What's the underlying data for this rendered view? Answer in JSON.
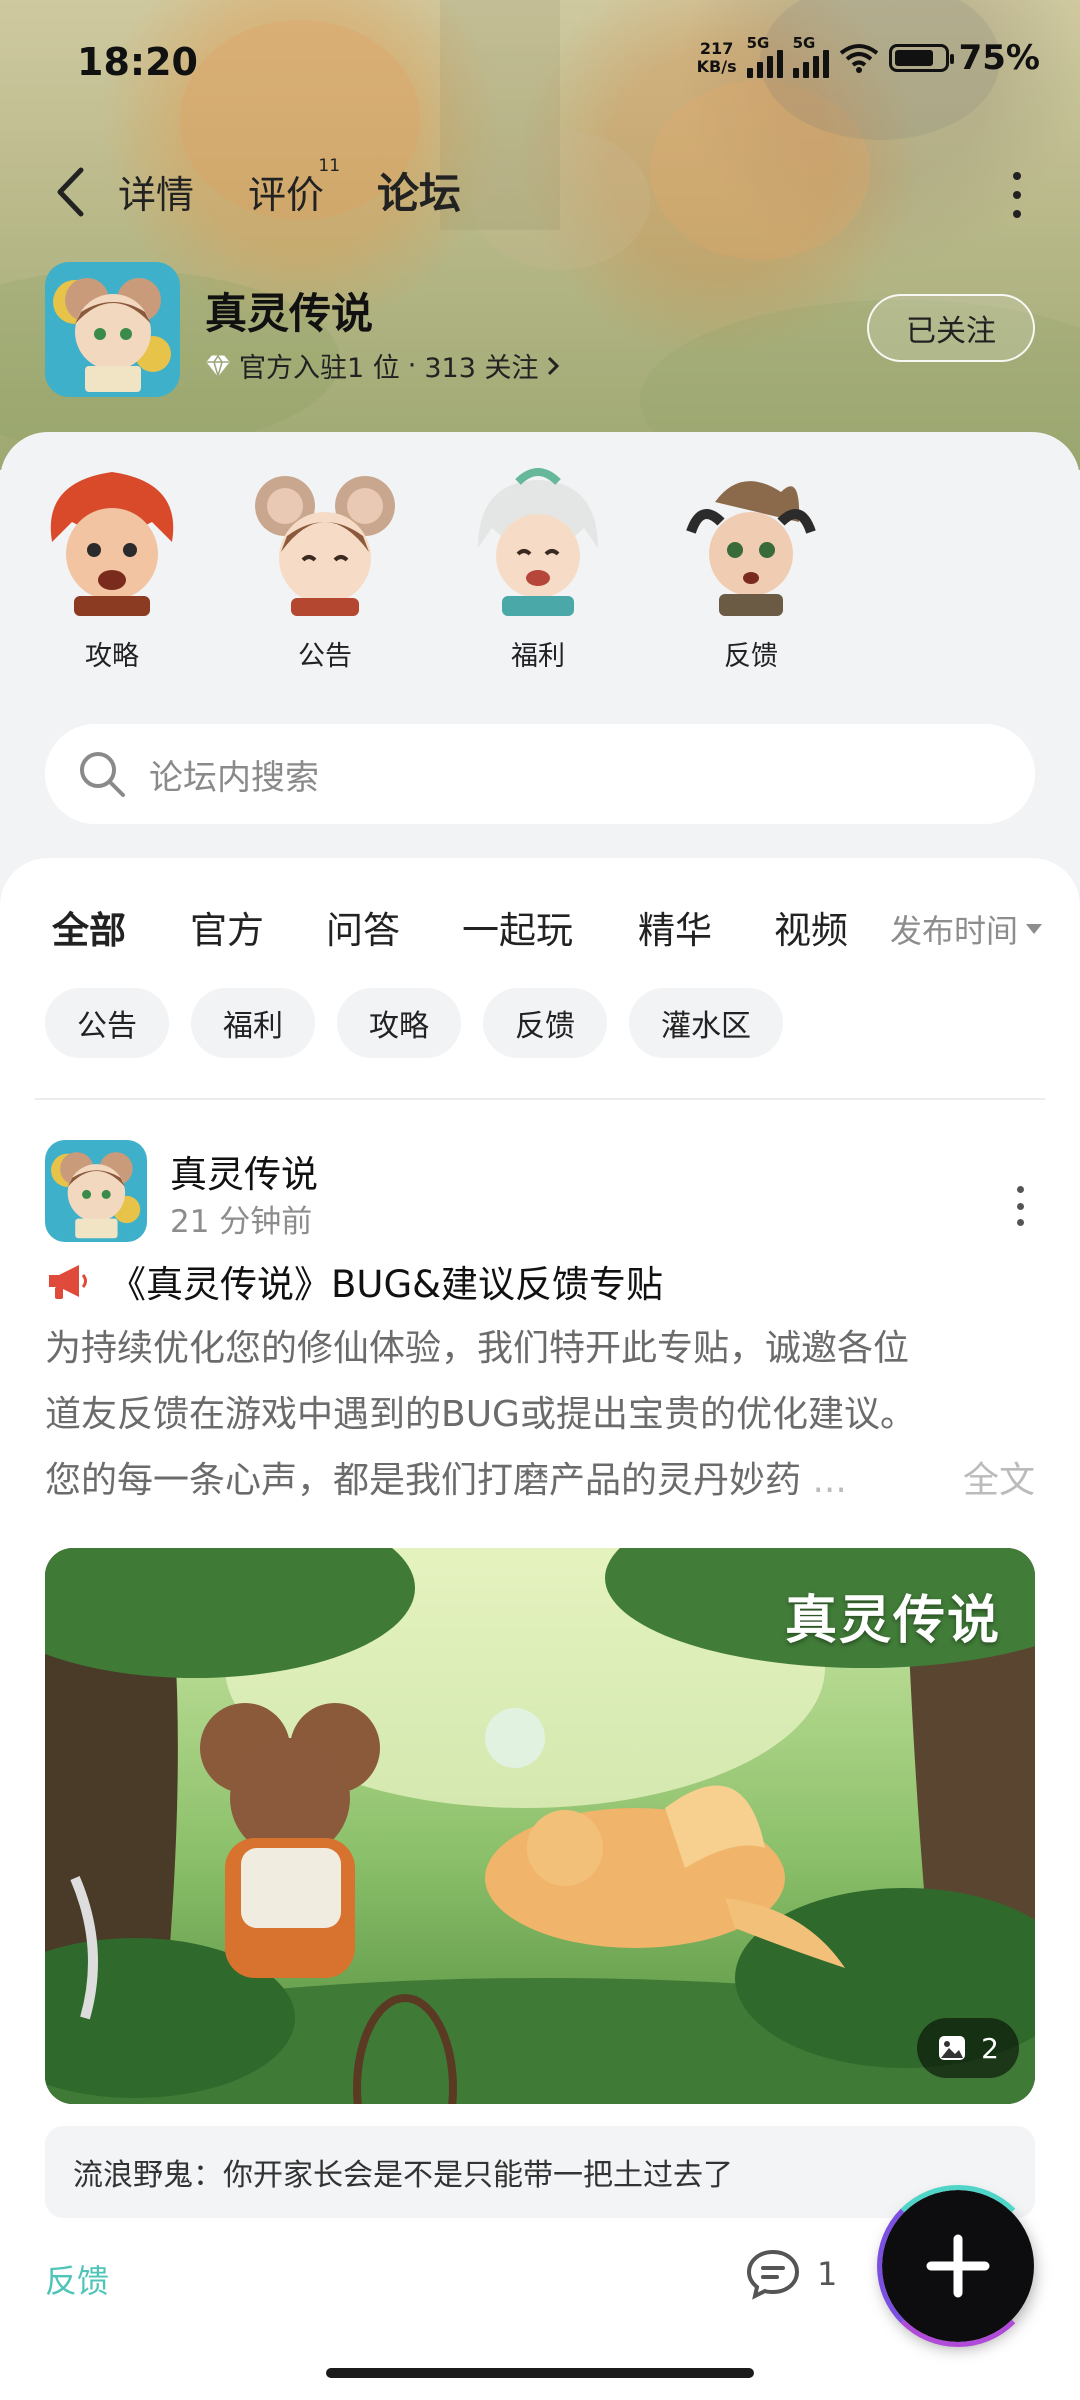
{
  "status_bar": {
    "time": "18:20",
    "net_speed_value": "217",
    "net_speed_unit": "KB/s",
    "sim1_type": "5G",
    "sim2_type": "5G",
    "battery_level": 0.75,
    "battery_text": "75%"
  },
  "nav": {
    "tabs": [
      {
        "label": "详情"
      },
      {
        "label": "评价",
        "badge": "11"
      },
      {
        "label": "论坛"
      }
    ],
    "active_tab": "论坛",
    "accent_color": "#4fd5c8"
  },
  "game": {
    "name": "真灵传说",
    "rank_text": "官方入驻1 位",
    "separator": "·",
    "followers_text": "313 关注",
    "follow_button": "已关注"
  },
  "categories": [
    {
      "label": "攻略",
      "icon": "red-hair-warrior-avatar"
    },
    {
      "label": "公告",
      "icon": "mouse-girl-avatar"
    },
    {
      "label": "福利",
      "icon": "white-hair-immortal-avatar"
    },
    {
      "label": "反馈",
      "icon": "horned-elf-avatar"
    }
  ],
  "search": {
    "placeholder": "论坛内搜索"
  },
  "feed": {
    "tabs": [
      "全部",
      "官方",
      "问答",
      "一起玩",
      "精华",
      "视频"
    ],
    "active_tab": "全部",
    "sort_label": "发布时间",
    "chips": [
      "公告",
      "福利",
      "攻略",
      "反馈",
      "灌水区"
    ]
  },
  "post": {
    "author": "真灵传说",
    "time": "21 分钟前",
    "title": "《真灵传说》BUG&建议反馈专贴",
    "body_lines": [
      "为持续优化您的修仙体验，我们特开此专贴，诚邀各位",
      "道友反馈在游戏中遇到的BUG或提出宝贵的优化建议。",
      "您的每一条心声，都是我们打磨产品的灵丹妙药"
    ],
    "ellipsis": "...",
    "full_text_link": "全文",
    "image_watermark": "真灵传说",
    "image_count": "2",
    "top_comment": "流浪野鬼：你开家长会是不是只能带一把土过去了",
    "tag": "反馈",
    "comment_count": "1"
  }
}
